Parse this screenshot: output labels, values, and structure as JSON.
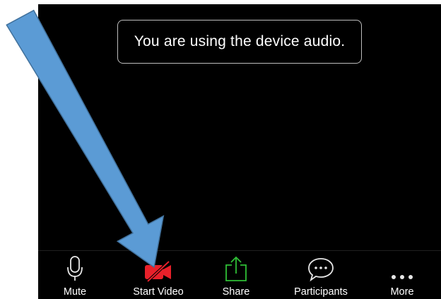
{
  "toast": {
    "text": "You are using the device audio."
  },
  "toolbar": {
    "mute_label": "Mute",
    "video_label": "Start Video",
    "share_label": "Share",
    "participants_label": "Participants",
    "more_label": "More"
  },
  "colors": {
    "background": "#000000",
    "video_off": "#e8202a",
    "share_green": "#2fbf36",
    "arrow_fill": "#5b9bd5",
    "arrow_stroke": "#41719c"
  },
  "icons": [
    "microphone-icon",
    "video-off-icon",
    "share-icon",
    "chat-bubble-icon",
    "more-dots-icon"
  ]
}
